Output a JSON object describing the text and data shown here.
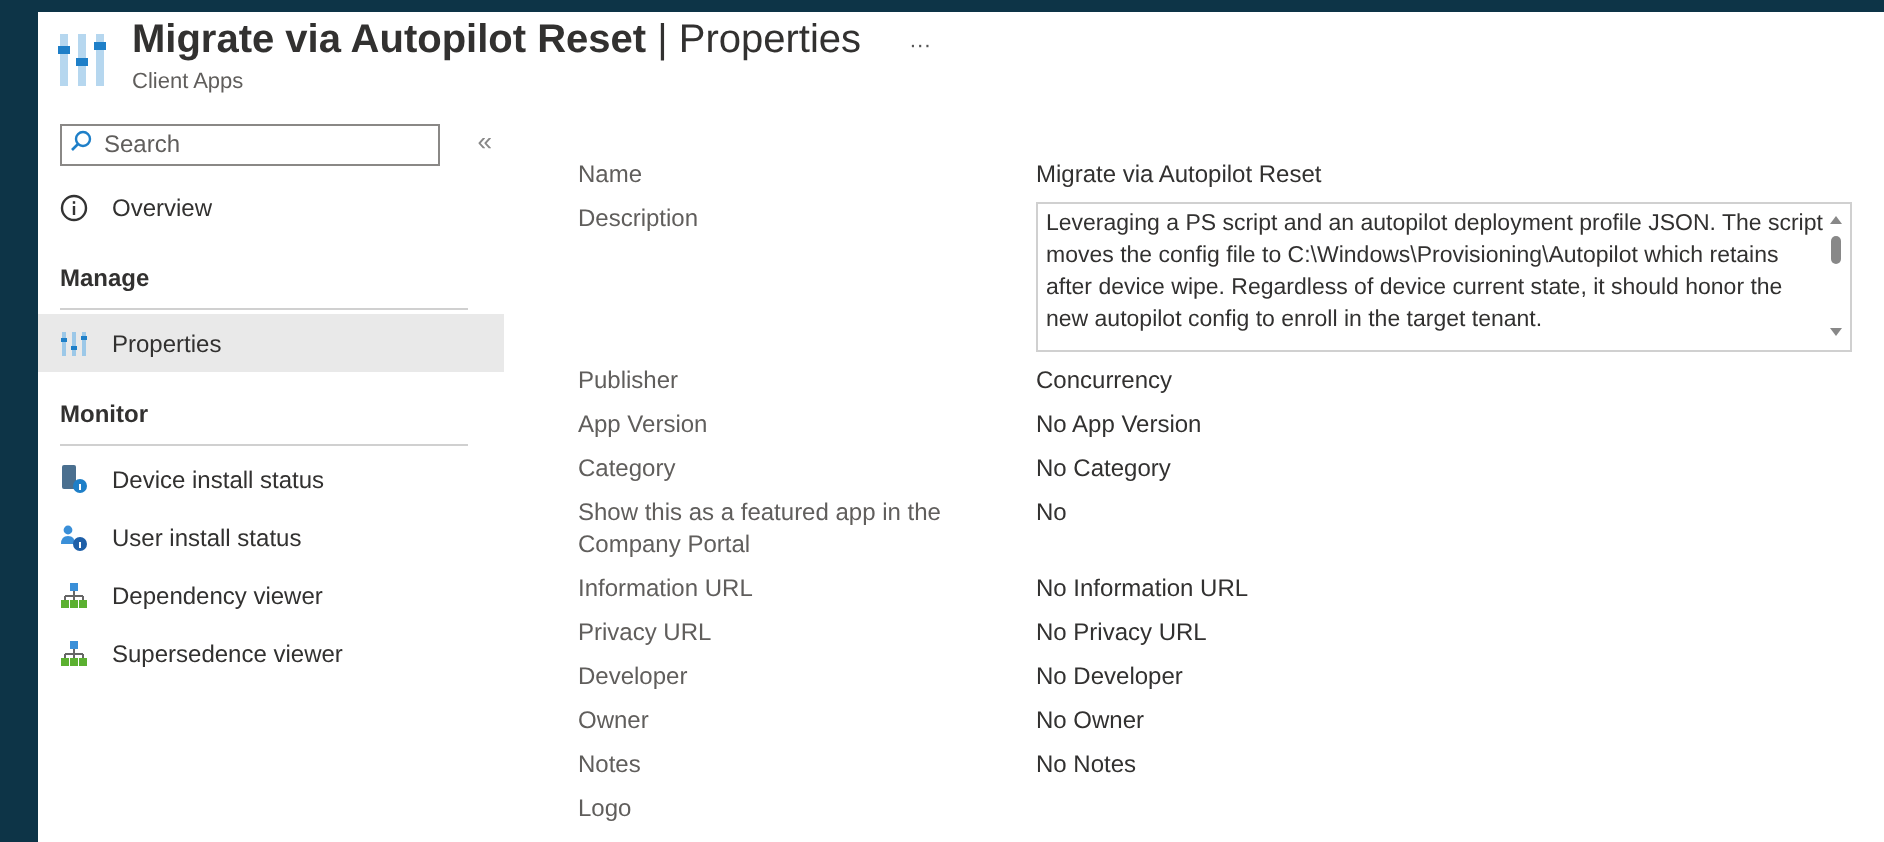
{
  "header": {
    "title": "Migrate via Autopilot Reset",
    "separator": "|",
    "section": "Properties",
    "subtitle": "Client Apps",
    "more": "···"
  },
  "sidebar": {
    "search": {
      "placeholder": "Search"
    },
    "collapse": "«",
    "groups": [
      {
        "items": [
          {
            "label": "Overview",
            "kind": "info",
            "selected": false
          }
        ]
      },
      {
        "heading": "Manage",
        "items": [
          {
            "label": "Properties",
            "kind": "sliders",
            "selected": true
          }
        ]
      },
      {
        "heading": "Monitor",
        "items": [
          {
            "label": "Device install status",
            "kind": "device",
            "selected": false
          },
          {
            "label": "User install status",
            "kind": "user",
            "selected": false
          },
          {
            "label": "Dependency viewer",
            "kind": "hierarchy",
            "selected": false
          },
          {
            "label": "Supersedence viewer",
            "kind": "hierarchy",
            "selected": false
          }
        ]
      }
    ]
  },
  "properties": [
    {
      "label": "Name",
      "value": "Migrate via Autopilot Reset",
      "kind": "text"
    },
    {
      "label": "Description",
      "value": "Leveraging a PS script and an autopilot deployment profile JSON. The script moves the config file to C:\\Windows\\Provisioning\\Autopilot which retains after device wipe. Regardless of device current state, it should honor the new autopilot config to enroll in the target tenant.",
      "kind": "textarea"
    },
    {
      "label": "Publisher",
      "value": "Concurrency",
      "kind": "text"
    },
    {
      "label": "App Version",
      "value": "No App Version",
      "kind": "text"
    },
    {
      "label": "Category",
      "value": "No Category",
      "kind": "text"
    },
    {
      "label": "Show this as a featured app in the Company Portal",
      "value": "No",
      "kind": "text"
    },
    {
      "label": "Information URL",
      "value": "No Information URL",
      "kind": "text"
    },
    {
      "label": "Privacy URL",
      "value": "No Privacy URL",
      "kind": "text"
    },
    {
      "label": "Developer",
      "value": "No Developer",
      "kind": "text"
    },
    {
      "label": "Owner",
      "value": "No Owner",
      "kind": "text"
    },
    {
      "label": "Notes",
      "value": "No Notes",
      "kind": "text"
    },
    {
      "label": "Logo",
      "kind": "text"
    }
  ]
}
